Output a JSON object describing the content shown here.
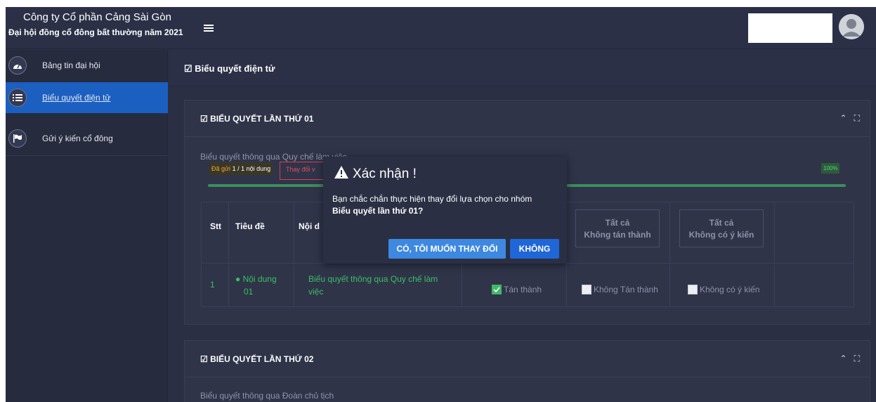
{
  "header": {
    "company": "Công ty Cổ phần Cảng Sài Gòn",
    "meeting": "Đại hội đồng cổ đông bất thường năm 2021"
  },
  "sidebar": {
    "items": [
      {
        "label": "Bảng tin đại hội",
        "icon": "dashboard-icon"
      },
      {
        "label": "Biểu quyết điện tử",
        "icon": "list-icon",
        "active": true
      },
      {
        "label": "Gửi ý kiến cổ đông",
        "icon": "flag-icon"
      }
    ]
  },
  "breadcrumb": "Biểu quyết điện tử",
  "vote1": {
    "title": "BIỂU QUYẾT LẦN THỨ 01",
    "subtitle": "Biểu quyết thông qua Quy chế làm việc",
    "sent_prefix": "Đã gửi",
    "sent_count": "1 / 1 nội dung",
    "change_label": "Thay đổi v",
    "progress_pct": "100%",
    "progress": 1.0,
    "columns": {
      "stt": "Stt",
      "title": "Tiêu đề",
      "content": "Nội d",
      "all_disagree_1": "Tất cả",
      "all_disagree_2": "Không tán thành",
      "all_noopinion_1": "Tất cả",
      "all_noopinion_2": "Không có ý kiến"
    },
    "rows": [
      {
        "stt": "1",
        "title_1": "Nội dung",
        "title_2": "01",
        "content_1": "Biểu quyết thông qua Quy chế làm",
        "content_2": "việc",
        "agree": "Tán thành",
        "agree_checked": true,
        "disagree": "Không Tán thành",
        "noopinion": "Không có ý kiến"
      }
    ]
  },
  "vote2": {
    "title": "BIỂU QUYẾT LẦN THỨ 02",
    "subtitle": "Biểu quyết thông qua Đoàn chủ tịch"
  },
  "modal": {
    "title": "Xác nhận !",
    "body_1": "Bạn chắc chắn thực hiện thay đổi lựa chọn cho nhóm",
    "body_2": "Biểu quyết lần thứ 01?",
    "confirm": "CÓ, TÔI MUỐN THAY ĐỔI",
    "cancel": "KHÔNG"
  },
  "colors": {
    "accent": "#1b5fc1",
    "success": "#3bbf62",
    "warning": "#f0a830",
    "danger": "#e0505f"
  }
}
